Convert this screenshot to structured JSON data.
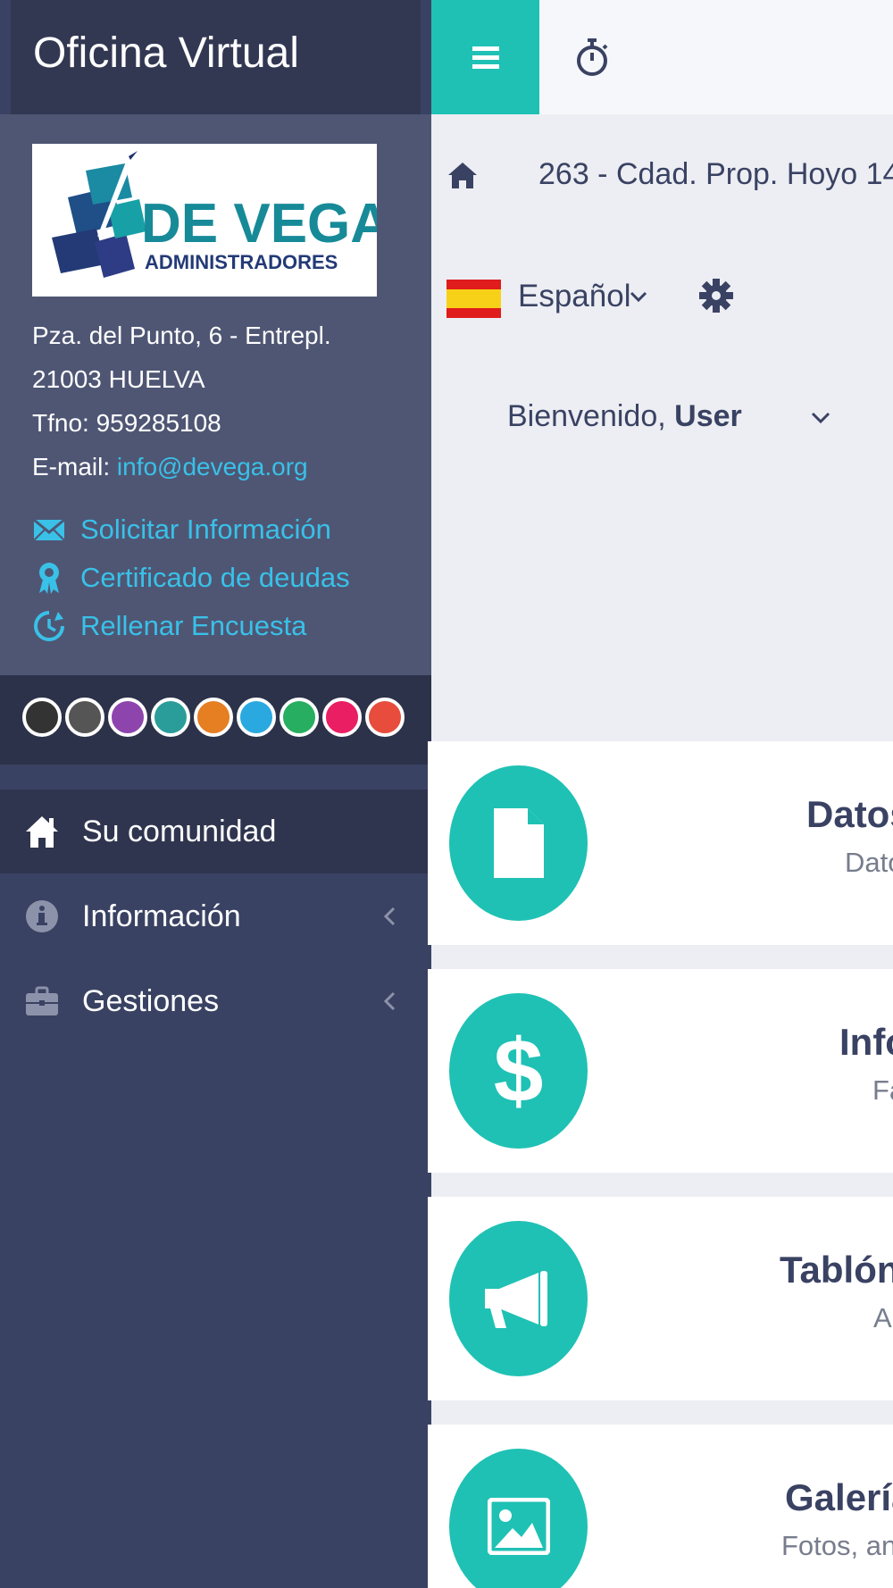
{
  "app": {
    "title": "Oficina Virtual"
  },
  "colors": {
    "accent": "#1fc1b4",
    "link": "#39c1e8",
    "sidebar": "#3a4263"
  },
  "company": {
    "logo_name": "DE VEGA",
    "logo_sub": "ADMINISTRADORES",
    "address_line1": "Pza. del Punto, 6 - Entrepl.",
    "address_line2": "21003 HUELVA",
    "phone": "Tfno: 959285108",
    "email_label": "E-mail: ",
    "email": "info@devega.org"
  },
  "quick_links": [
    {
      "label": "Solicitar Información",
      "icon": "envelope-icon"
    },
    {
      "label": "Certificado de deudas",
      "icon": "award-icon"
    },
    {
      "label": "Rellenar Encuesta",
      "icon": "survey-icon"
    }
  ],
  "theme_swatches": [
    "#333333",
    "#555555",
    "#8e44ad",
    "#2a9d9a",
    "#e67e22",
    "#29a9e0",
    "#27ae60",
    "#e91e63",
    "#e74c3c"
  ],
  "nav": [
    {
      "label": "Su comunidad",
      "icon": "home-icon",
      "active": true
    },
    {
      "label": "Información",
      "icon": "info-icon",
      "active": false
    },
    {
      "label": "Gestiones",
      "icon": "briefcase-icon",
      "active": false
    }
  ],
  "breadcrumb": {
    "community": "263 - Cdad. Prop. Hoyo 14"
  },
  "language": {
    "selected": "Español"
  },
  "user": {
    "greeting": "Bienvenido, ",
    "name": "User"
  },
  "cards": [
    {
      "title": "Datos",
      "subtitle": "Dato",
      "icon": "document-icon"
    },
    {
      "title": "Info",
      "subtitle": "Fa",
      "icon": "dollar-icon"
    },
    {
      "title": "Tablón",
      "subtitle": "A",
      "icon": "megaphone-icon"
    },
    {
      "title": "Galería",
      "subtitle": "Fotos, an",
      "icon": "image-icon"
    }
  ]
}
